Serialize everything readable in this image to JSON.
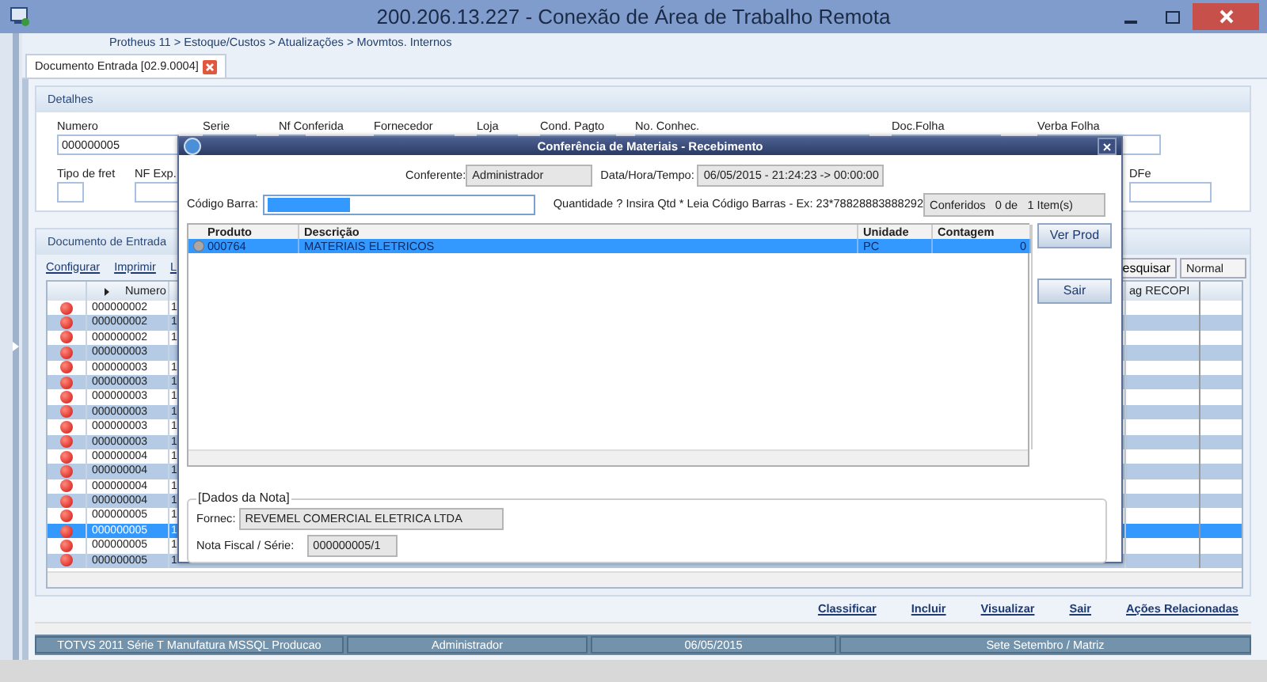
{
  "window": {
    "title": "200.206.13.227 - Conexão de Área de Trabalho Remota"
  },
  "breadcrumb": "Protheus 11 > Estoque/Custos > Atualizações > Movmtos. Internos",
  "tab": {
    "label": "Documento Entrada [02.9.0004]",
    "selected": true
  },
  "details": {
    "title": "Detalhes",
    "row_1": [
      {
        "label": "Numero",
        "value": "000000005"
      },
      {
        "label": "Serie"
      },
      {
        "label": "Nf Conferida"
      },
      {
        "label": "Fornecedor"
      },
      {
        "label": "Loja"
      },
      {
        "label": "Cond. Pagto"
      },
      {
        "label": "No. Conhec."
      },
      {
        "label": "Doc.Folha"
      },
      {
        "label": "Verba Folha"
      }
    ],
    "row_2": [
      {
        "label": "Tipo de fret"
      },
      {
        "label": "NF Exp."
      },
      {
        "label": "DFe"
      }
    ]
  },
  "document": {
    "title": "Documento de Entrada",
    "links": [
      "Configurar",
      "Imprimir",
      "L"
    ],
    "search_button": "esquisar",
    "view_select": "Normal",
    "columns": [
      "Numero",
      "ag RECOPI"
    ],
    "rows": [
      {
        "numero": "000000002",
        "column_2": "1",
        "selected": false
      },
      {
        "numero": "000000002",
        "column_2": "1",
        "selected": false
      },
      {
        "numero": "000000002",
        "column_2": "1",
        "selected": false
      },
      {
        "numero": "000000003",
        "selected": false
      },
      {
        "numero": "000000003",
        "column_2": "1",
        "selected": false
      },
      {
        "numero": "000000003",
        "column_2": "1",
        "selected": false
      },
      {
        "numero": "000000003",
        "column_2": "1",
        "selected": false
      },
      {
        "numero": "000000003",
        "column_2": "1",
        "selected": false
      },
      {
        "numero": "000000003",
        "column_2": "1",
        "selected": false
      },
      {
        "numero": "000000003",
        "column_2": "1",
        "selected": false
      },
      {
        "numero": "000000004",
        "column_2": "1",
        "selected": false
      },
      {
        "numero": "000000004",
        "column_2": "1",
        "selected": false
      },
      {
        "numero": "000000004",
        "column_2": "1",
        "selected": false
      },
      {
        "numero": "000000004",
        "column_2": "1",
        "selected": false
      },
      {
        "numero": "000000005",
        "column_2": "1",
        "selected": false
      },
      {
        "numero": "000000005",
        "column_2": "1",
        "selected": true
      },
      {
        "numero": "000000005",
        "column_2": "1",
        "selected": false
      },
      {
        "numero": "000000005",
        "column_2": "1",
        "selected": false
      }
    ]
  },
  "actions": [
    "Classificar",
    "Incluir",
    "Visualizar",
    "Sair",
    "Ações Relacionadas"
  ],
  "status_bar": [
    "TOTVS 2011 Série T Manufatura MSSQL Producao",
    "Administrador",
    "06/05/2015",
    "Sete Setembro / Matriz"
  ],
  "dialog": {
    "title": "Conferência de Materiais - Recebimento",
    "conferente": {
      "label": "Conferente:",
      "value": "Administrador"
    },
    "datetime": {
      "label": "Data/Hora/Tempo:",
      "value": "06/05/2015 - 21:24:23 -> 00:00:00"
    },
    "barcode": {
      "label": "Código Barra:",
      "text_selected": true
    },
    "hint": "Quantidade ? Insira Qtd * Leia Código Barras - Ex: 23*78828883888292",
    "counter": "Conferidos   0 de   1 Item(s)",
    "columns": [
      "Produto",
      "Descrição",
      "Unidade",
      "Contagem"
    ],
    "rows": [
      {
        "cells": [
          "000764",
          "MATERIAIS ELETRICOS",
          "PC",
          "0"
        ],
        "selected": true
      }
    ],
    "buttons": [
      "Ver Prod",
      "Sair"
    ],
    "note": {
      "legend": "[Dados da Nota]",
      "fornec_label": "Fornec:",
      "fornec_value": "REVEMEL COMERCIAL ELETRICA LTDA",
      "nf_label": "Nota Fiscal / Série:",
      "nf_value": "000000005/1"
    }
  }
}
